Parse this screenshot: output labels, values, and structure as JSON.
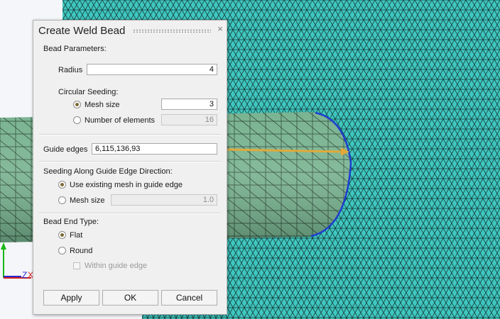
{
  "dialog": {
    "title": "Create Weld Bead",
    "close_glyph": "×",
    "bead_parameters": {
      "section_label": "Bead Parameters:",
      "radius_label": "Radius",
      "radius_value": "4"
    },
    "circular_seeding": {
      "section_label": "Circular Seeding:",
      "mesh_size_label": "Mesh size",
      "mesh_size_value": "3",
      "mesh_size_selected": true,
      "num_elements_label": "Number of elements",
      "num_elements_value": "16"
    },
    "guide_edges": {
      "label": "Guide edges",
      "value": "6,115,136,93"
    },
    "seeding_guide": {
      "section_label": "Seeding Along Guide Edge Direction:",
      "use_existing_label": "Use existing mesh in guide edge",
      "use_existing_selected": true,
      "mesh_size_label": "Mesh size",
      "mesh_size_value": "1.0"
    },
    "bead_end_type": {
      "section_label": "Bead End Type:",
      "flat_label": "Flat",
      "flat_selected": true,
      "round_label": "Round",
      "within_label": "Within guide edge"
    },
    "buttons": {
      "apply": "Apply",
      "ok": "OK",
      "cancel": "Cancel"
    }
  },
  "axis": {
    "z_label": "Z",
    "x_label": "X"
  },
  "colors": {
    "plate_mesh": "#3fc7bf",
    "bead_mesh": "#74b08c",
    "guide_edge": "#1f3ccf",
    "arrow": "#e0aa3a",
    "axis_y": "#18b818",
    "axis_z": "#2a2ad0"
  }
}
